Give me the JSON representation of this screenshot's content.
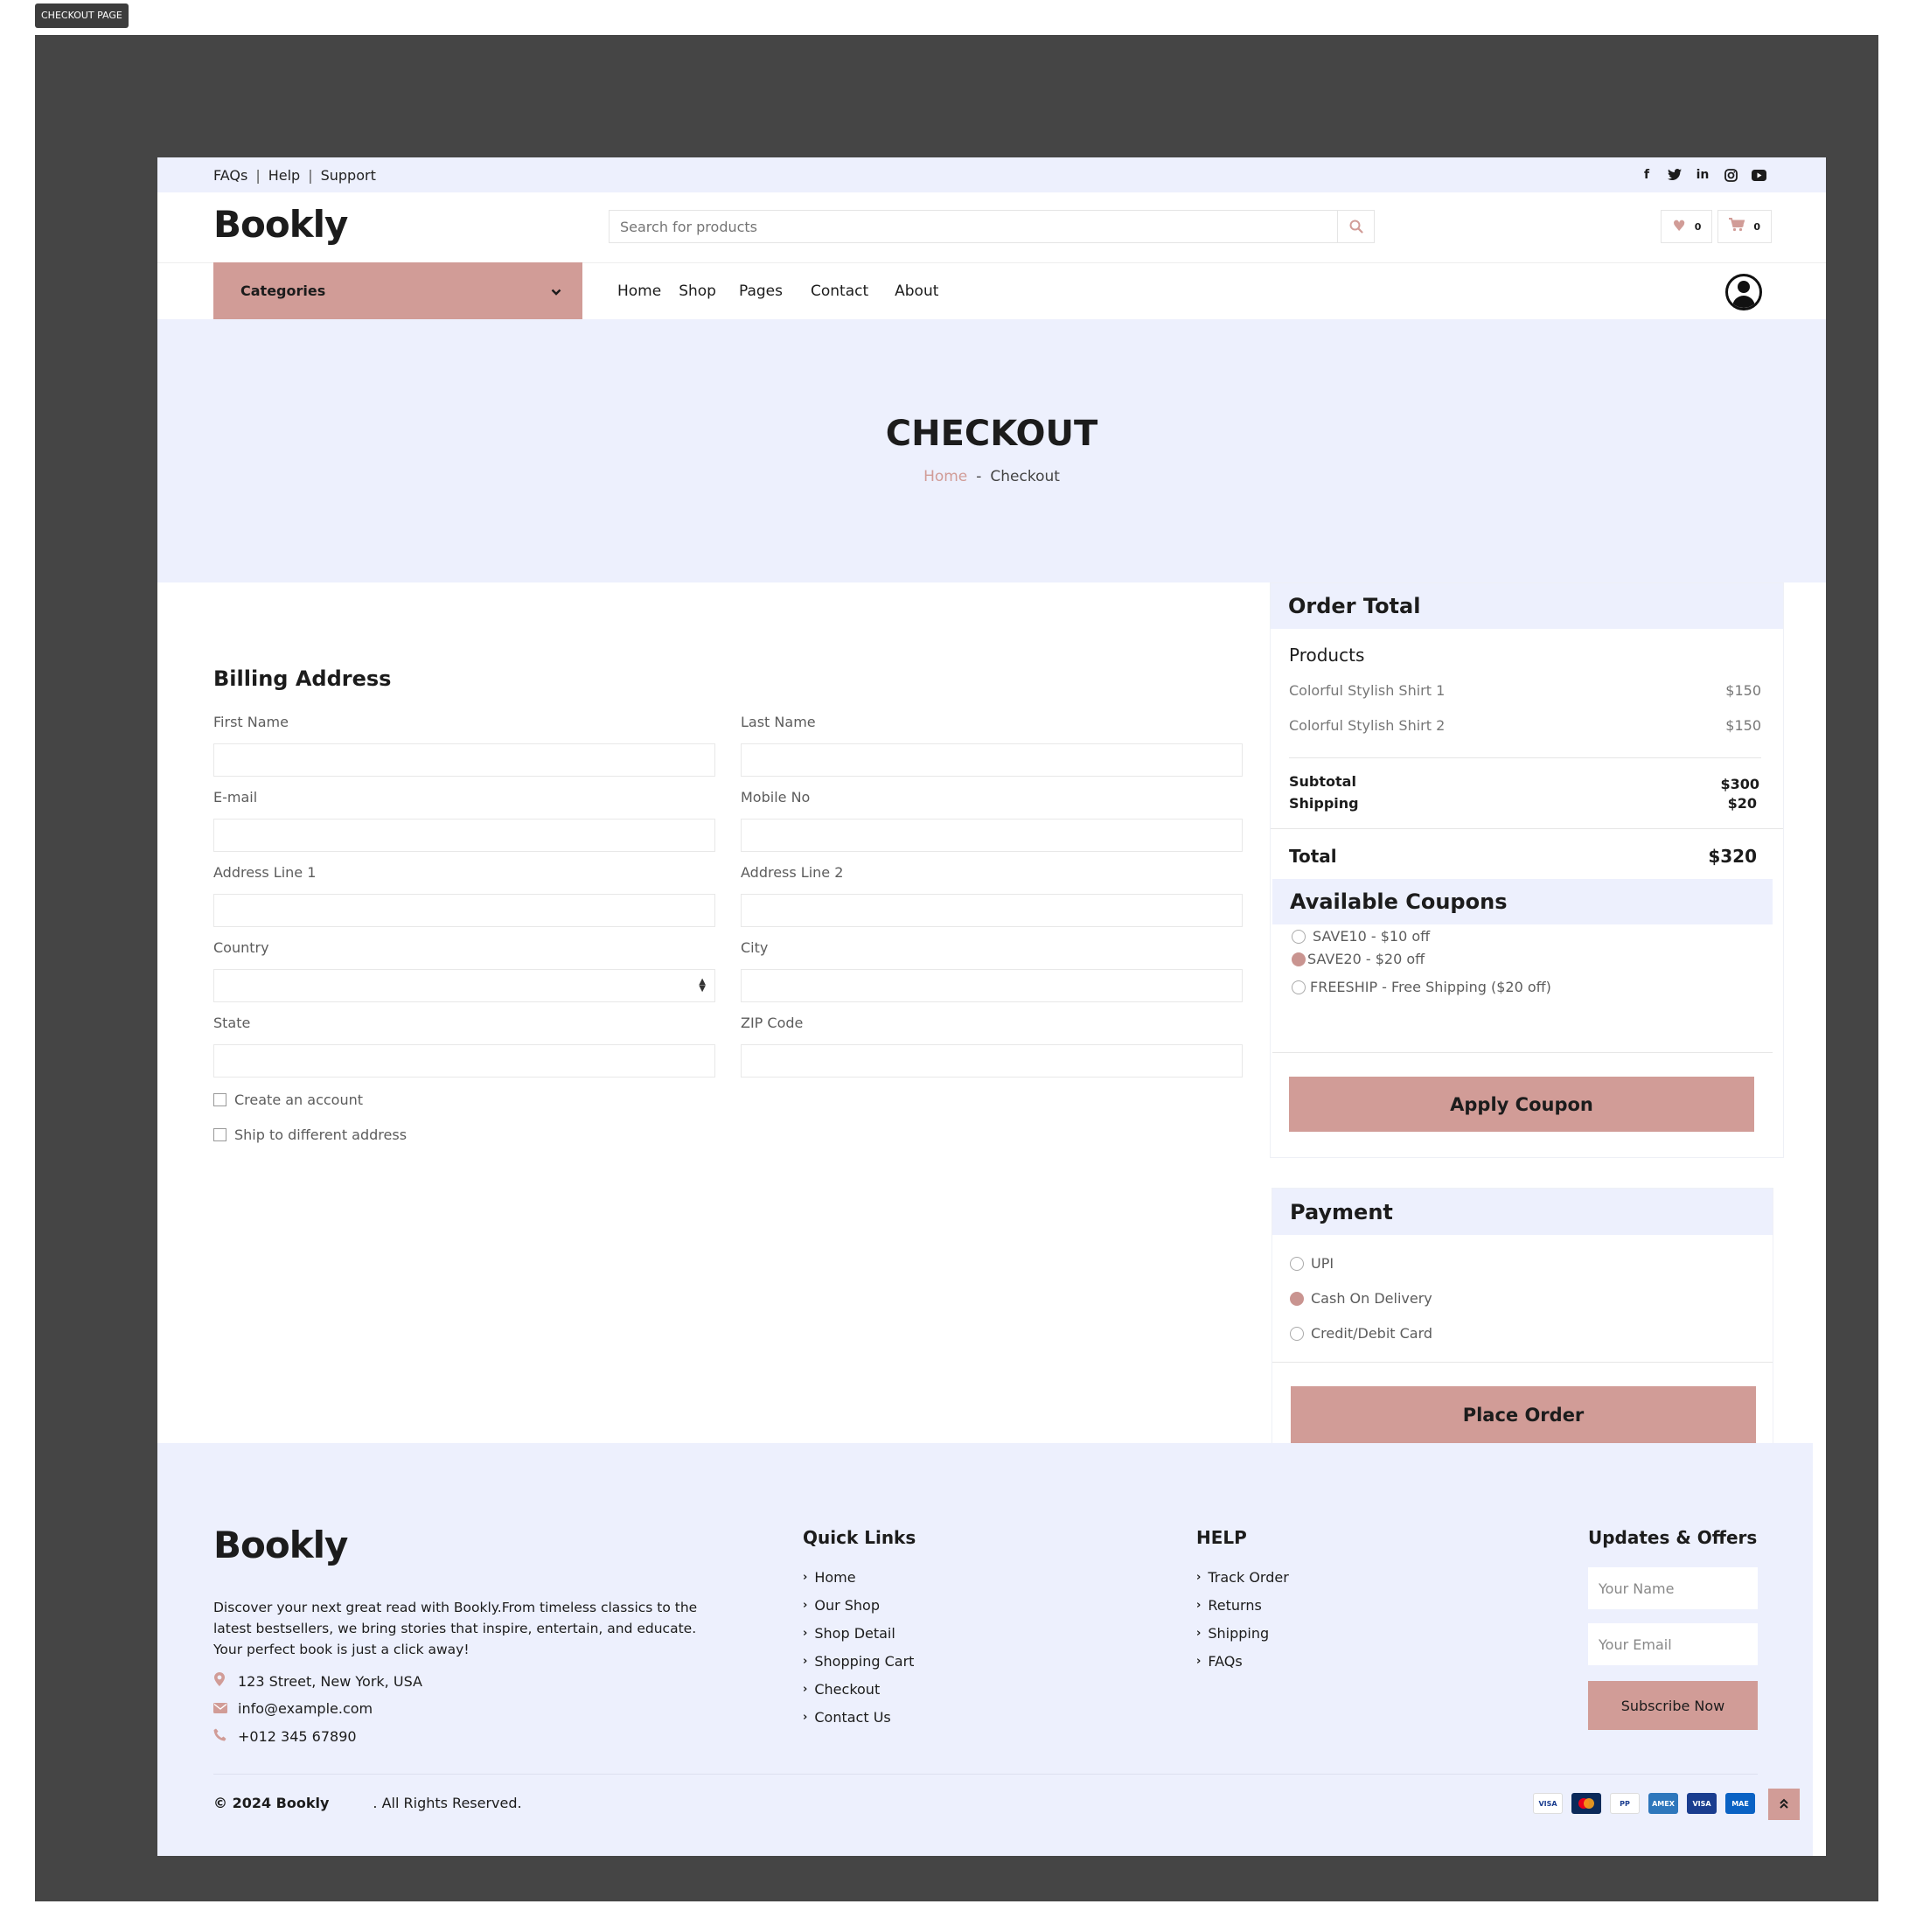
{
  "page_tag": "CHECKOUT PAGE",
  "topbar": {
    "links": [
      "FAQs",
      "Help",
      "Support"
    ],
    "sep": "|",
    "social_icons": [
      "facebook-icon",
      "twitter-icon",
      "linkedin-icon",
      "instagram-icon",
      "youtube-icon"
    ]
  },
  "header": {
    "logo": "Bookly",
    "search_placeholder": "Search for products",
    "wishlist_count": "0",
    "cart_count": "0"
  },
  "nav": {
    "categories_label": "Categories",
    "items": [
      "Home",
      "Shop",
      "Pages",
      "Contact",
      "About"
    ]
  },
  "hero": {
    "title": "CHECKOUT",
    "breadcrumb_home": "Home",
    "breadcrumb_sep": "-",
    "breadcrumb_current": "Checkout"
  },
  "billing": {
    "title": "Billing Address",
    "fields": {
      "first_name": "First Name",
      "last_name": "Last Name",
      "email": "E-mail",
      "mobile": "Mobile No",
      "address1": "Address Line 1",
      "address2": "Address Line 2",
      "country": "Country",
      "city": "City",
      "state": "State",
      "zip": "ZIP Code"
    },
    "create_account": "Create an account",
    "ship_different": "Ship to different address"
  },
  "order": {
    "title": "Order Total",
    "products_title": "Products",
    "products": [
      {
        "name": "Colorful Stylish Shirt 1",
        "price": "$150"
      },
      {
        "name": "Colorful Stylish Shirt 2",
        "price": "$150"
      }
    ],
    "subtotal_label": "Subtotal",
    "subtotal": "$300",
    "shipping_label": "Shipping",
    "shipping": "$20",
    "total_label": "Total",
    "total": "$320"
  },
  "coupons": {
    "title": "Available Coupons",
    "options": [
      {
        "label": "SAVE10 - $10 off",
        "selected": false
      },
      {
        "label": "SAVE20 - $20 off",
        "selected": true
      },
      {
        "label": "FREESHIP - Free Shipping ($20 off)",
        "selected": false
      }
    ],
    "apply_label": "Apply Coupon"
  },
  "payment": {
    "title": "Payment",
    "options": [
      {
        "label": "UPI",
        "selected": false
      },
      {
        "label": "Cash On Delivery",
        "selected": true
      },
      {
        "label": "Credit/Debit Card",
        "selected": false
      }
    ],
    "place_order_label": "Place Order"
  },
  "footer": {
    "logo": "Bookly",
    "description": "Discover your next great read with Bookly.From timeless classics to the latest bestsellers, we bring stories that inspire, entertain, and educate. Your perfect book is just a click away!",
    "address": "123 Street, New York, USA",
    "email": "info@example.com",
    "phone": "+012 345 67890",
    "quick_links_title": "Quick Links",
    "quick_links": [
      "Home",
      "Our Shop",
      "Shop Detail",
      "Shopping Cart",
      "Checkout",
      "Contact Us"
    ],
    "help_title": "HELP",
    "help_links": [
      "Track Order",
      "Returns",
      "Shipping",
      "FAQs"
    ],
    "updates_title": "Updates & Offers",
    "name_placeholder": "Your Name",
    "email_placeholder": "Your Email",
    "subscribe_label": "Subscribe Now",
    "copyright_brand": "© 2024 Bookly",
    "copyright_rest": ". All Rights Reserved.",
    "payment_icons": [
      "VISA",
      "MC",
      "PP",
      "AMEX",
      "VISA",
      "MAE"
    ],
    "colors": {
      "accent": "#d19c97",
      "light_bg": "#edf0fd",
      "frame": "#454545"
    }
  }
}
